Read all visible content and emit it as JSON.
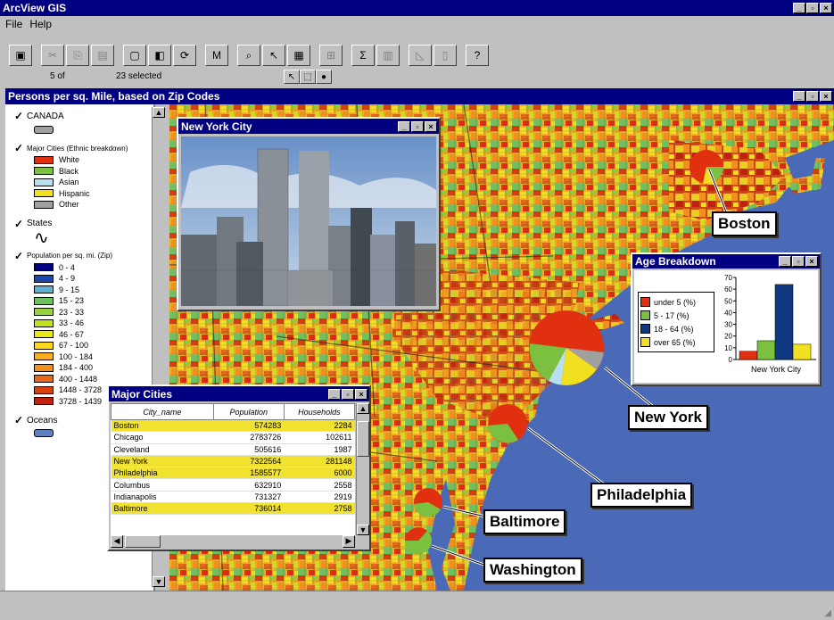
{
  "app": {
    "title": "ArcView GIS"
  },
  "menu": [
    "File",
    "Help"
  ],
  "status": {
    "count": "5 of",
    "selected": "23 selected"
  },
  "view": {
    "title": "Persons per sq. Mile, based on Zip Codes"
  },
  "legend": {
    "canada": "CANADA",
    "major_cities": "Major Cities (Ethnic breakdown)",
    "ethnic": [
      {
        "label": "White",
        "color": "#e03010"
      },
      {
        "label": "Black",
        "color": "#7cc040"
      },
      {
        "label": "Asian",
        "color": "#b8e0f0"
      },
      {
        "label": "Hispanic",
        "color": "#f0e020"
      },
      {
        "label": "Other",
        "color": "#a0a0a0"
      }
    ],
    "states": "States",
    "population": "Population per sq. mi. (Zip)",
    "pop_classes": [
      {
        "label": "0 - 4",
        "color": "#000080"
      },
      {
        "label": "4 - 9",
        "color": "#1848b0"
      },
      {
        "label": "9 - 15",
        "color": "#60b0d0"
      },
      {
        "label": "15 - 23",
        "color": "#70c060"
      },
      {
        "label": "23 - 33",
        "color": "#98d040"
      },
      {
        "label": "33 - 46",
        "color": "#c0e020"
      },
      {
        "label": "46 - 67",
        "color": "#e8e818"
      },
      {
        "label": "67 - 100",
        "color": "#f8d820"
      },
      {
        "label": "100 - 184",
        "color": "#f8b020"
      },
      {
        "label": "184 - 400",
        "color": "#f09020"
      },
      {
        "label": "400 - 1448",
        "color": "#e86818"
      },
      {
        "label": "1448 - 3728",
        "color": "#d84010"
      },
      {
        "label": "3728 - 1439",
        "color": "#c02010"
      }
    ],
    "oceans": "Oceans",
    "ocean_color": "#6080c0"
  },
  "nyc_window": {
    "title": "New York City"
  },
  "age_window": {
    "title": "Age Breakdown",
    "legend": [
      {
        "label": "under 5 (%)",
        "color": "#e03010"
      },
      {
        "label": "5 - 17 (%)",
        "color": "#7cc040"
      },
      {
        "label": "18 - 64 (%)",
        "color": "#103880"
      },
      {
        "label": "over 65 (%)",
        "color": "#f0e020"
      }
    ]
  },
  "chart_data": {
    "type": "bar",
    "categories": [
      "New York City"
    ],
    "series": [
      {
        "name": "under 5 (%)",
        "values": [
          7
        ]
      },
      {
        "name": "5 - 17 (%)",
        "values": [
          16
        ]
      },
      {
        "name": "18 - 64 (%)",
        "values": [
          64
        ]
      },
      {
        "name": "over 65 (%)",
        "values": [
          13
        ]
      }
    ],
    "ylim": [
      0,
      70
    ],
    "yticks": [
      "0",
      "10",
      "20",
      "30",
      "40",
      "50",
      "60",
      "70"
    ],
    "xlabel": "New York City"
  },
  "cities_window": {
    "title": "Major Cities",
    "columns": [
      "City_name",
      "Population",
      "Households"
    ],
    "rows": [
      {
        "name": "Boston",
        "pop": "574283",
        "hh": "2284",
        "hl": true
      },
      {
        "name": "Chicago",
        "pop": "2783726",
        "hh": "102611",
        "hl": false
      },
      {
        "name": "Cleveland",
        "pop": "505616",
        "hh": "1987",
        "hl": false
      },
      {
        "name": "New York",
        "pop": "7322564",
        "hh": "281148",
        "hl": true
      },
      {
        "name": "Philadelphia",
        "pop": "1585577",
        "hh": "6000",
        "hl": true
      },
      {
        "name": "Columbus",
        "pop": "632910",
        "hh": "2558",
        "hl": false
      },
      {
        "name": "Indianapolis",
        "pop": "731327",
        "hh": "2919",
        "hl": false
      },
      {
        "name": "Baltimore",
        "pop": "736014",
        "hh": "2758",
        "hl": true
      }
    ]
  },
  "callouts": {
    "boston": "Boston",
    "new_york": "New York",
    "philadelphia": "Philadelphia",
    "baltimore": "Baltimore",
    "washington": "Washington"
  }
}
